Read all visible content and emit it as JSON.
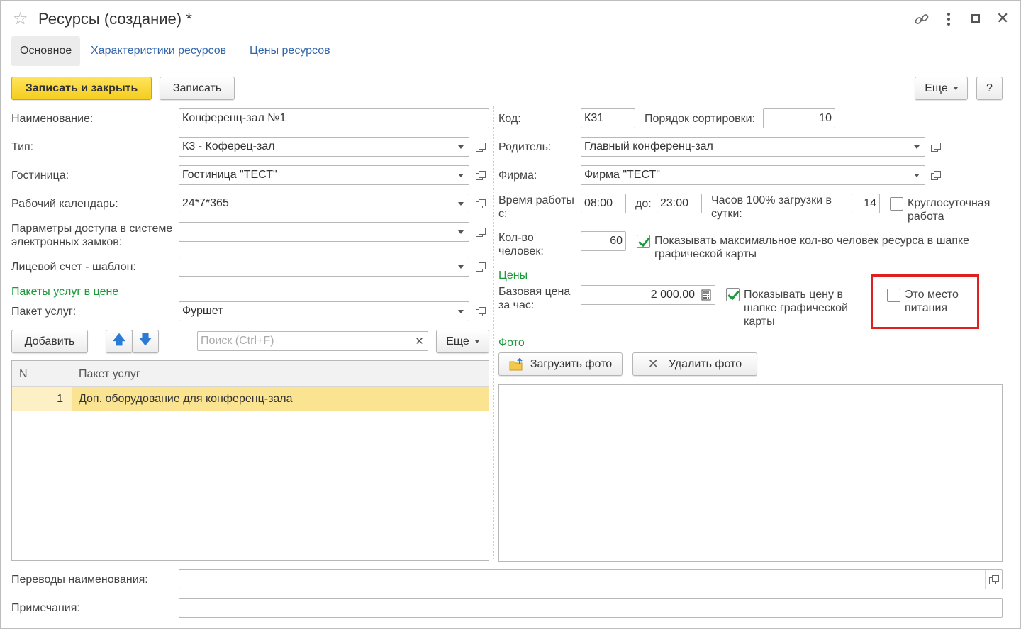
{
  "window": {
    "title": "Ресурсы (создание) *"
  },
  "tabs": [
    {
      "label": "Основное"
    },
    {
      "label": "Характеристики ресурсов"
    },
    {
      "label": "Цены ресурсов"
    }
  ],
  "toolbar": {
    "save_close": "Записать и закрыть",
    "save": "Записать",
    "more": "Еще",
    "help": "?"
  },
  "left": {
    "name_label": "Наименование:",
    "name_value": "Конференц-зал №1",
    "type_label": "Тип:",
    "type_value": "К3 - Коферец-зал",
    "hotel_label": "Гостиница:",
    "hotel_value": "Гостиница \"ТЕСТ\"",
    "calendar_label": "Рабочий календарь:",
    "calendar_value": "24*7*365",
    "access_label": "Параметры доступа в системе электронных замков:",
    "access_value": "",
    "account_label": "Лицевой счет - шаблон:",
    "account_value": "",
    "packages_heading": "Пакеты услуг в цене",
    "package_label": "Пакет услуг:",
    "package_value": "Фуршет",
    "add_button": "Добавить",
    "search_placeholder": "Поиск (Ctrl+F)",
    "more": "Еще",
    "table": {
      "columns": [
        "N",
        "Пакет услуг"
      ],
      "rows": [
        {
          "n": "1",
          "name": "Доп. оборудование для конференц-зала"
        }
      ]
    }
  },
  "right": {
    "code_label": "Код:",
    "code_value": "К31",
    "sort_label": "Порядок сортировки:",
    "sort_value": "10",
    "parent_label": "Родитель:",
    "parent_value": "Главный конференц-зал",
    "firm_label": "Фирма:",
    "firm_value": "Фирма \"ТЕСТ\"",
    "work_time_label": "Время работы с:",
    "work_from": "08:00",
    "to_label": "до:",
    "work_to": "23:00",
    "hours_label": "Часов 100% загрузки в сутки:",
    "hours_value": "14",
    "round_clock_label": "Круглосуточная работа",
    "round_clock_checked": false,
    "people_label": "Кол-во человек:",
    "people_value": "60",
    "show_max_label": "Показывать максимальное кол-во человек ресурса в шапке графической карты",
    "show_max_checked": true,
    "prices_heading": "Цены",
    "base_price_label": "Базовая цена за час:",
    "base_price_value": "2 000,00",
    "show_price_label": "Показывать цену в шапке графической карты",
    "show_price_checked": true,
    "food_place_label": "Это место питания",
    "food_place_checked": false,
    "photo_heading": "Фото",
    "upload_photo": "Загрузить фото",
    "delete_photo": "Удалить фото"
  },
  "bottom": {
    "translations_label": "Переводы наименования:",
    "translations_value": "",
    "notes_label": "Примечания:",
    "notes_value": ""
  },
  "colors": {
    "primary_button": "#f5cd1f",
    "link": "#3366aa",
    "section_heading": "#1a9a3a",
    "selected_row": "#fbe491",
    "highlight_box": "#e02020"
  }
}
